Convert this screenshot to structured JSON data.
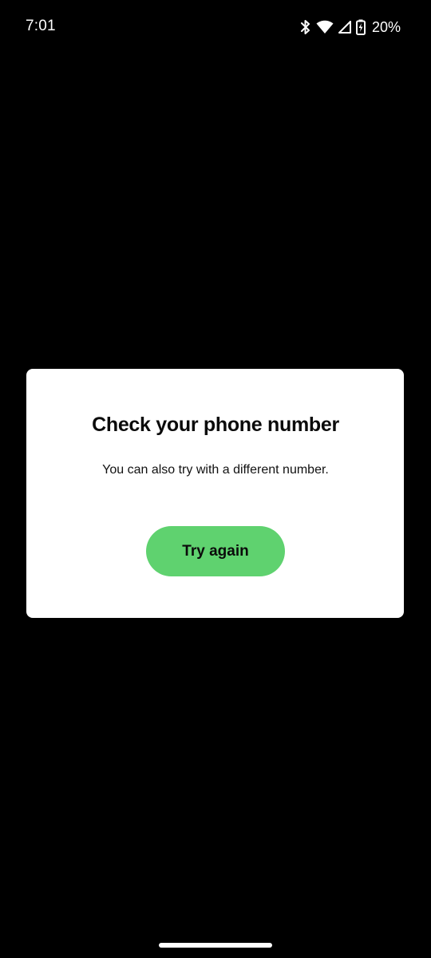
{
  "status_bar": {
    "time": "7:01",
    "battery_percent": "20%",
    "icons": [
      "bluetooth-icon",
      "wifi-icon",
      "cell-signal-icon",
      "battery-charging-icon"
    ]
  },
  "dialog": {
    "title": "Check your phone number",
    "body": "You can also try with a different number.",
    "button_label": "Try again"
  },
  "colors": {
    "background": "#000000",
    "dialog_background": "#ffffff",
    "accent": "#5fd26f",
    "text_dark": "#0b0b0b"
  }
}
